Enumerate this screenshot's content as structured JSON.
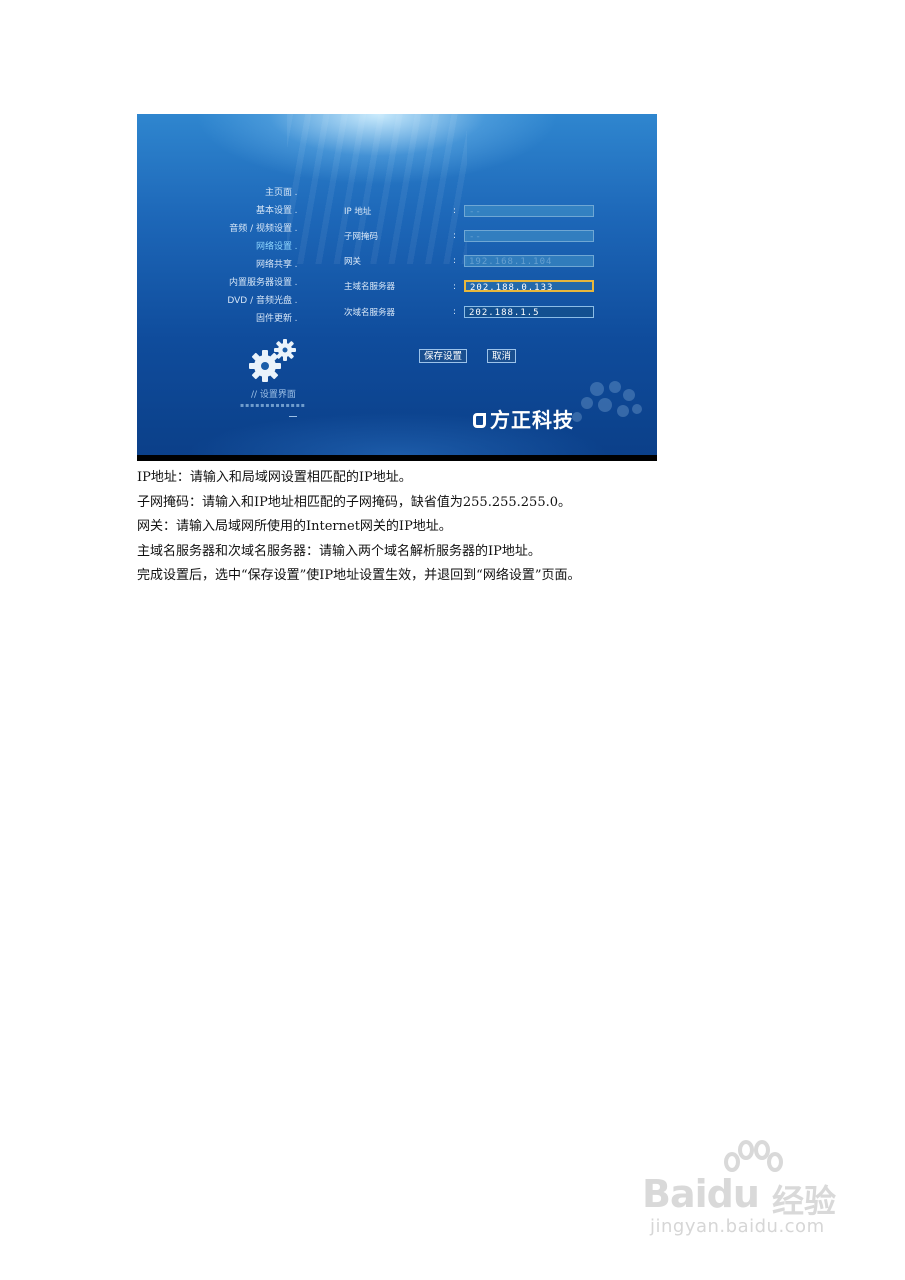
{
  "screen": {
    "menu": [
      {
        "label": "主页面",
        "active": false
      },
      {
        "label": "基本设置",
        "active": false
      },
      {
        "label": "音频 / 视频设置",
        "active": false
      },
      {
        "label": "网络设置",
        "active": true
      },
      {
        "label": "网络共享",
        "active": false
      },
      {
        "label": "内置服务器设置",
        "active": false
      },
      {
        "label": "DVD / 音频光盘",
        "active": false
      },
      {
        "label": "固件更新",
        "active": false
      }
    ],
    "menu_dot": ".",
    "settings_label": "// 设置界面",
    "form": {
      "colon": ":",
      "ip_label": "IP 地址",
      "ip_value": "--",
      "subnet_label": "子网掩码",
      "subnet_value": "--",
      "gateway_label": "网关",
      "gateway_value": "192.168.1.104",
      "primary_dns_label": "主域名服务器",
      "primary_dns_value": "202.188.0.133",
      "secondary_dns_label": "次域名服务器",
      "secondary_dns_value": "202.188.1.5"
    },
    "buttons": {
      "save": "保存设置",
      "cancel": "取消"
    },
    "logo": "方正科技"
  },
  "article": {
    "lines": [
      "IP地址：请输入和局域网设置相匹配的IP地址。",
      "子网掩码：请输入和IP地址相匹配的子网掩码，缺省值为255.255.255.0。",
      "网关：请输入局域网所使用的Internet网关的IP地址。",
      "主域名服务器和次域名服务器：请输入两个域名解析服务器的IP地址。",
      "完成设置后，选中“保存设置”使IP地址设置生效，并退回到“网络设置”页面。"
    ]
  },
  "watermark": {
    "brand": "Baidu",
    "brand_cn": "经验",
    "url": "jingyan.baidu.com"
  }
}
